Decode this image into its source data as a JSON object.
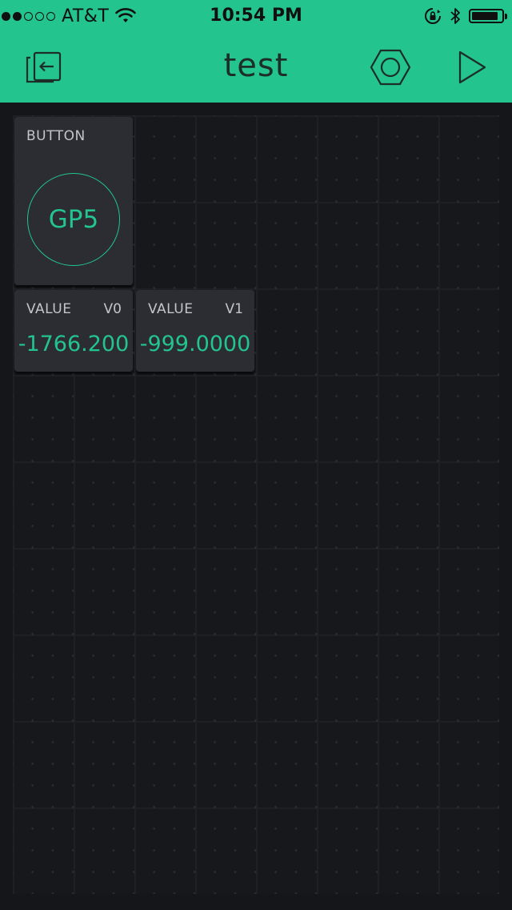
{
  "status_bar": {
    "carrier": "AT&T",
    "time": "10:54 PM",
    "signal_dots_filled": 2,
    "signal_dots_total": 5,
    "battery_level": 0.9
  },
  "header": {
    "title": "test",
    "back_icon": "exit-project-icon",
    "settings_icon": "hexagon-settings-icon",
    "play_icon": "play-icon"
  },
  "widgets": {
    "button": {
      "label": "BUTTON",
      "pin": "GP5"
    },
    "value_v0": {
      "label": "VALUE",
      "pin": "V0",
      "value": "-1766.200"
    },
    "value_v1": {
      "label": "VALUE",
      "pin": "V1",
      "value": "-999.0000"
    }
  },
  "colors": {
    "accent": "#23c48e",
    "background": "#15161a",
    "widget_bg": "#2b2d32",
    "text_muted": "#c3c5c8"
  }
}
